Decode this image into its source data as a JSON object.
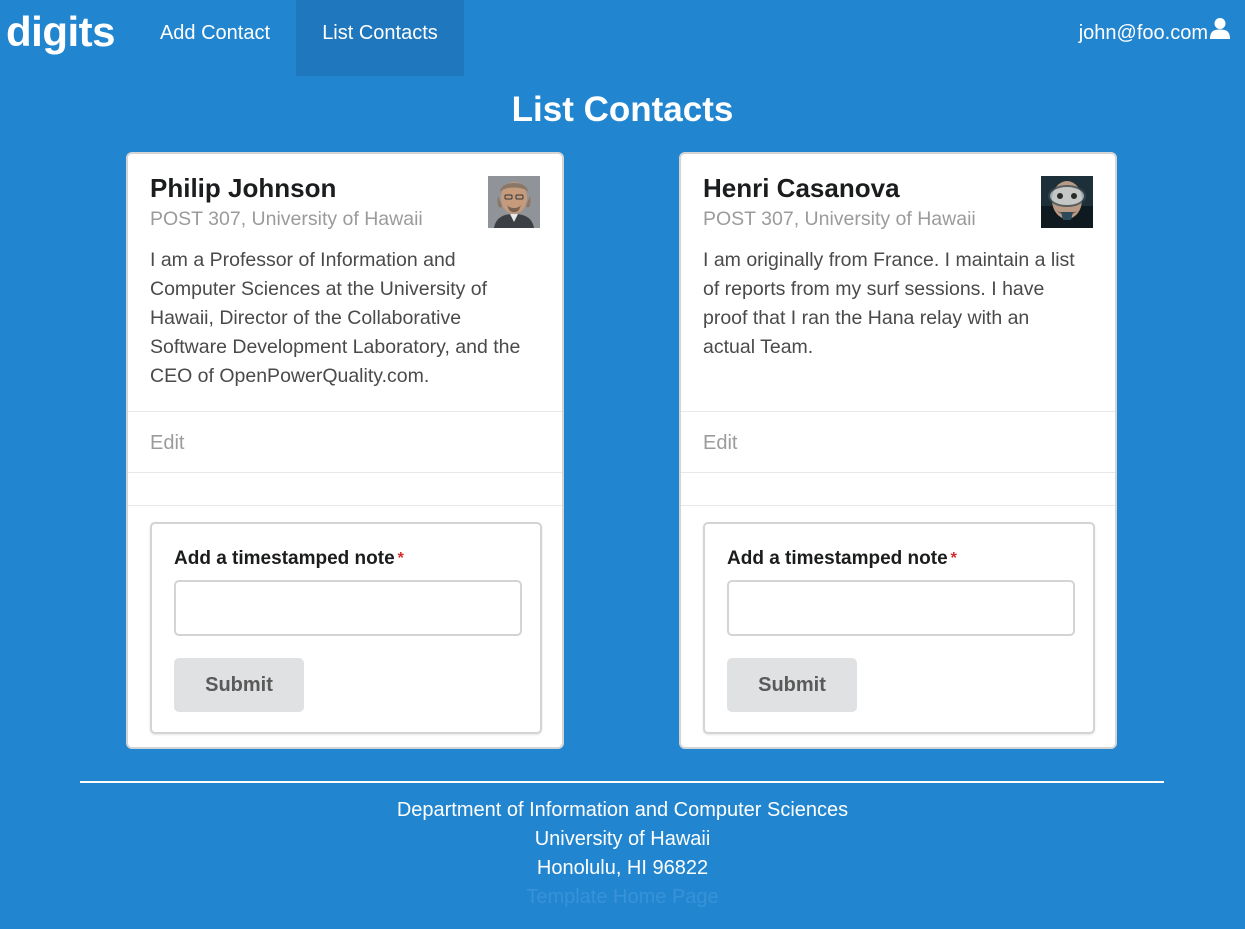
{
  "navbar": {
    "brand": "digits",
    "items": [
      {
        "label": "Add Contact"
      },
      {
        "label": "List Contacts",
        "active": true
      }
    ],
    "user": {
      "email": "john@foo.com",
      "icon": "user-icon"
    }
  },
  "page": {
    "title": "List Contacts"
  },
  "contacts": [
    {
      "name": "Philip Johnson",
      "address": "POST 307, University of Hawaii",
      "description": "I am a Professor of Information and Computer Sciences at the University of Hawaii, Director of the Collaborative Software Development Laboratory, and the CEO of OpenPowerQuality.com.",
      "edit_label": "Edit",
      "note_label": "Add a timestamped note",
      "required_mark": "*",
      "note_value": "",
      "submit_label": "Submit"
    },
    {
      "name": "Henri Casanova",
      "address": "POST 307, University of Hawaii",
      "description": "I am originally from France. I maintain a list of reports from my surf sessions. I have proof that I ran the Hana relay with an actual Team.",
      "edit_label": "Edit",
      "note_label": "Add a timestamped note",
      "required_mark": "*",
      "note_value": "",
      "submit_label": "Submit"
    }
  ],
  "footer": {
    "line1": "Department of Information and Computer Sciences",
    "line2": "University of Hawaii",
    "line3": "Honolulu, HI 96822",
    "link": "Template Home Page"
  },
  "colors": {
    "background": "#2185d0",
    "active_nav": "#1f77bd",
    "required": "#db2828"
  }
}
